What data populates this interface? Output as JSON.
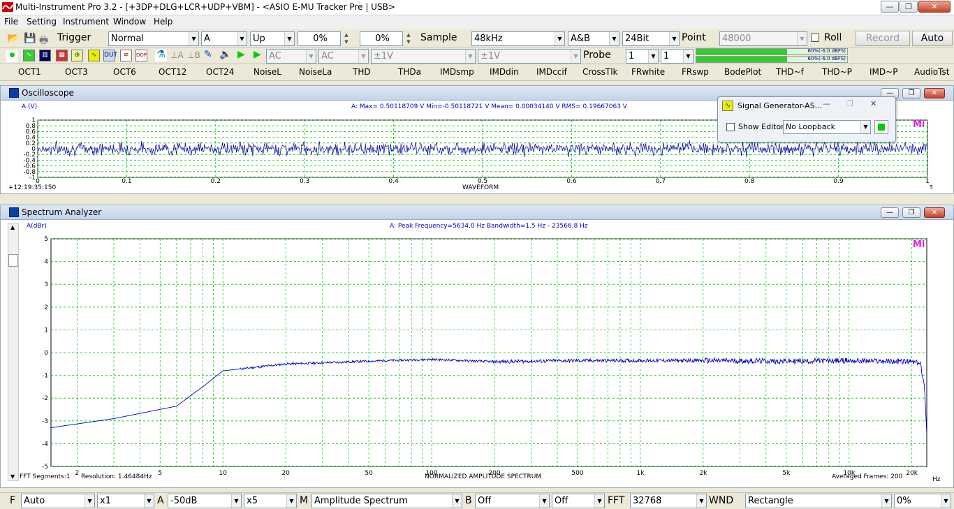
{
  "window": {
    "title": "Multi-Instrument Pro 3.2   -   [+3DP+DLG+LCR+UDP+VBM]   -   <ASIO E-MU Tracker Pre | USB>",
    "minimize": "—",
    "restore": "❐",
    "close": "✕"
  },
  "menu": [
    "File",
    "Setting",
    "Instrument",
    "Window",
    "Help"
  ],
  "toolbar1": {
    "trigger_label": "Trigger",
    "trigger_mode": "Normal",
    "trigger_channel": "A",
    "trigger_edge": "Up",
    "trigger_level": "0%",
    "trigger_delay": "0%",
    "sample_label": "Sample",
    "sample_rate": "48kHz",
    "channels": "A&B",
    "bit_depth": "24Bit",
    "point_label": "Point",
    "points": "48000",
    "roll_label": "Roll",
    "record_label": "Record",
    "auto_label": "Auto"
  },
  "toolbar2": {
    "coupling_a": "AC",
    "coupling_b": "AC",
    "range_a": "±1V",
    "range_b": "±1V",
    "probe_label": "Probe",
    "probe_a": "1",
    "probe_b": "1",
    "meter_a_text": "60%(-6.0 dBFS)",
    "meter_b_text": "60%(-6.0 dBFS)",
    "meter_a_level": 0.6,
    "meter_b_level": 0.6
  },
  "measure_tools": [
    "OCT1",
    "OCT3",
    "OCT6",
    "OCT12",
    "OCT24",
    "NoiseL",
    "NoiseLa",
    "THD",
    "THDa",
    "IMDsmp",
    "IMDdin",
    "IMDccif",
    "CrossTlk",
    "FRwhite",
    "FRswp",
    "BodePlot",
    "THD~f",
    "THD~P",
    "IMD~P",
    "AudioTst"
  ],
  "oscilloscope": {
    "title": "Oscilloscope",
    "y_unit": "A (V)",
    "stats": "A: Max= 0.50118709 V  Min=-0.50118721 V  Mean= 0.00034140 V  RMS= 0.19667063 V",
    "timestamp": "+12:19:35:150",
    "x_title": "WAVEFORM",
    "x_unit": "s",
    "x_ticks": [
      "0",
      "0.1",
      "0.2",
      "0.3",
      "0.4",
      "0.5",
      "0.6",
      "0.7",
      "0.8",
      "0.9",
      "1"
    ],
    "y_ticks": [
      "1",
      "0.8",
      "0.6",
      "0.4",
      "0.2",
      "0",
      "-0.2",
      "-0.4",
      "-0.6",
      "-0.8",
      "-1"
    ],
    "mi_logo": "Mi"
  },
  "siggen": {
    "title": "Signal Generator-AS...",
    "show_editor": "Show Editor",
    "loopback": "No Loopback"
  },
  "spectrum": {
    "title": "Spectrum Analyzer",
    "y_unit": "A(dBr)",
    "stats": "A: Peak Frequency=5634.0 Hz  Bandwidth=1.5 Hz - 23566.8 Hz",
    "fft_segments": "FFT Segments:1",
    "resolution": "Resolution: 1.46484Hz",
    "x_title": "NORMALIZED AMPLITUDE SPECTRUM",
    "averaged": "Averaged Frames: 200",
    "x_unit": "Hz",
    "mi_logo": "Mi",
    "x_ticks": [
      "2",
      "5",
      "10",
      "20",
      "50",
      "100",
      "200",
      "500",
      "1k",
      "2k",
      "5k",
      "10k",
      "20k"
    ],
    "y_ticks": [
      "5",
      "4",
      "3",
      "2",
      "1",
      "0",
      "-1",
      "-2",
      "-3",
      "-4",
      "-5"
    ]
  },
  "bottom": {
    "f_label": "F",
    "f_mode": "Auto",
    "x_scale": "x1",
    "a_label": "A",
    "a_range": "-50dB",
    "y_scale": "x5",
    "m_label": "M",
    "mode": "Amplitude Spectrum",
    "b_label": "B",
    "b_mode": "Off",
    "b_mode2": "Off",
    "fft_label": "FFT",
    "fft_size": "32768",
    "wnd_label": "WND",
    "window": "Rectangle",
    "overlap": "0%"
  },
  "chart_data": [
    {
      "type": "line",
      "title": "WAVEFORM",
      "xlabel": "s",
      "ylabel": "A (V)",
      "xlim": [
        0,
        1
      ],
      "ylim": [
        -1,
        1
      ],
      "grid": true,
      "series": [
        {
          "name": "A",
          "description_values": {
            "max": 0.50118709,
            "min": -0.50118721,
            "mean": 0.0003414,
            "rms": 0.19667063
          }
        }
      ]
    },
    {
      "type": "line",
      "title": "NORMALIZED AMPLITUDE SPECTRUM",
      "xlabel": "Hz",
      "ylabel": "A(dBr)",
      "xscale": "log",
      "xlim": [
        1.5,
        23566.8
      ],
      "ylim": [
        -5,
        5
      ],
      "grid": true,
      "series": [
        {
          "name": "A",
          "x": [
            1.5,
            3,
            6,
            8,
            10,
            20,
            30,
            60,
            100,
            200,
            500,
            1000,
            2000,
            5000,
            10000,
            20000,
            22000,
            23000,
            23566.8
          ],
          "y": [
            -3.3,
            -2.9,
            -2.35,
            -1.5,
            -0.8,
            -0.5,
            -0.45,
            -0.35,
            -0.3,
            -0.4,
            -0.35,
            -0.35,
            -0.35,
            -0.38,
            -0.35,
            -0.4,
            -0.5,
            -1.5,
            -3.6
          ]
        }
      ]
    }
  ]
}
